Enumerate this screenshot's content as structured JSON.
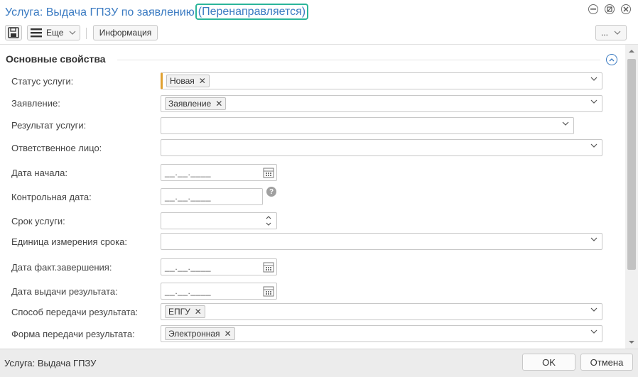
{
  "window": {
    "title": "Услуга: Выдача ГПЗУ по заявлению",
    "status": "(Перенаправляется)",
    "colors": {
      "title": "#3b7bc2",
      "status_frame": "#2bb59a",
      "required_marker": "#e0a030"
    }
  },
  "toolbar": {
    "save_icon": "floppy-disk-icon",
    "more_label": "Еще",
    "info_label": "Информация",
    "dots_label": "..."
  },
  "section": {
    "title": "Основные свойства"
  },
  "fields": {
    "status": {
      "label": "Статус услуги:",
      "tag": "Новая"
    },
    "application": {
      "label": "Заявление:",
      "tag": "Заявление"
    },
    "result": {
      "label": "Результат услуги:"
    },
    "responsible": {
      "label": "Ответственное лицо:"
    },
    "start_date": {
      "label": "Дата начала:",
      "mask": "__.__.____"
    },
    "control_date": {
      "label": "Контрольная дата:",
      "mask": "__.__.____",
      "help": "?"
    },
    "term": {
      "label": "Срок услуги:"
    },
    "term_unit": {
      "label": "Единица измерения срока:"
    },
    "actual_end": {
      "label": "Дата факт.завершения:",
      "mask": "__.__.____"
    },
    "issue_date": {
      "label": "Дата выдачи результата:",
      "mask": "__.__.____"
    },
    "transfer_method": {
      "label": "Способ передачи результата:",
      "tag": "ЕПГУ"
    },
    "transfer_form": {
      "label": "Форма передачи результата:",
      "tag": "Электронная"
    }
  },
  "footer": {
    "label": "Услуга: Выдача ГПЗУ",
    "ok_label": "OK",
    "cancel_label": "Отмена"
  }
}
